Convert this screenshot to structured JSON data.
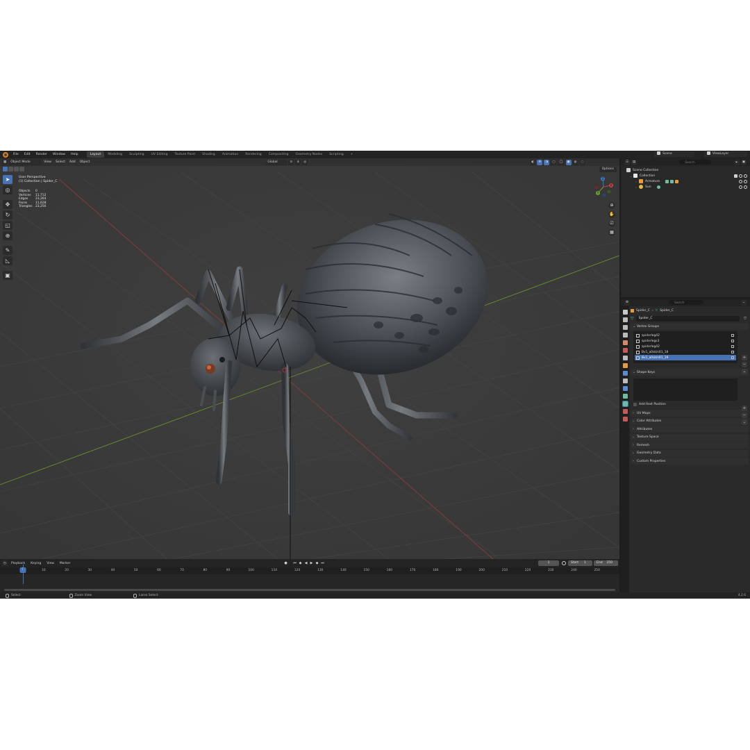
{
  "menu": [
    "File",
    "Edit",
    "Render",
    "Window",
    "Help"
  ],
  "workspaces": [
    {
      "label": "Layout",
      "active": true
    },
    {
      "label": "Modeling",
      "active": false
    },
    {
      "label": "Sculpting",
      "active": false
    },
    {
      "label": "UV Editing",
      "active": false
    },
    {
      "label": "Texture Paint",
      "active": false
    },
    {
      "label": "Shading",
      "active": false
    },
    {
      "label": "Animation",
      "active": false
    },
    {
      "label": "Rendering",
      "active": false
    },
    {
      "label": "Compositing",
      "active": false
    },
    {
      "label": "Geometry Nodes",
      "active": false
    },
    {
      "label": "Scripting",
      "active": false
    }
  ],
  "add_tab": "+",
  "scene": {
    "label": "Scene"
  },
  "view_layer": {
    "label": "ViewLayer"
  },
  "viewport": {
    "mode": "Object Mode",
    "menus": [
      "View",
      "Select",
      "Add",
      "Object"
    ],
    "orientation": "Global",
    "options": "Options",
    "perspective": "User Perspective",
    "collection_path": "(1) Collection | Spider_C",
    "stats": [
      {
        "label": "Objects",
        "value": "0"
      },
      {
        "label": "Vertices",
        "value": "11,712"
      },
      {
        "label": "Edges",
        "value": "23,264"
      },
      {
        "label": "Faces",
        "value": "11,628"
      },
      {
        "label": "Triangles",
        "value": "23,256"
      }
    ],
    "gizmo_axes": {
      "x": "X",
      "y": "Y",
      "z": "Z"
    },
    "colors": {
      "accent": "#4772b3",
      "x_axis": "#c4404a",
      "y_axis": "#6ba428",
      "z_axis": "#3b78c4"
    }
  },
  "timeline": {
    "menus": [
      "Playback",
      "Keying",
      "View",
      "Marker"
    ],
    "current_frame": "1",
    "start_label": "Start",
    "start": "1",
    "end_label": "End",
    "end": "250",
    "ticks": [
      "10",
      "20",
      "30",
      "40",
      "50",
      "60",
      "70",
      "80",
      "90",
      "100",
      "110",
      "120",
      "130",
      "140",
      "150",
      "160",
      "170",
      "180",
      "190",
      "200",
      "210",
      "220",
      "230",
      "240",
      "250"
    ],
    "frame_indicator": "1"
  },
  "statusbar": {
    "select": "Select",
    "zoom": "Zoom View",
    "lasso": "Lasso Select",
    "version": "4.2.0"
  },
  "outliner": {
    "search_placeholder": "Search",
    "scene_collection": "Scene Collection",
    "collection": "Collection",
    "armature": "Armature",
    "sun": "Sun"
  },
  "properties": {
    "search_placeholder": "Search",
    "crumb_object": "Spider_C",
    "crumb_mesh": "Spider_C",
    "mesh_name": "Spider_C",
    "vertex_groups_title": "Vertex Groups",
    "vertex_groups": [
      "spiderleg42",
      "spiderlegs3",
      "spiderleg42",
      "Bv1_a0skin01_18",
      "Bv1_a0skin01_19"
    ],
    "selected_vertex_group": 4,
    "shape_keys_title": "Shape Keys",
    "add_rest_position": "Add Rest Position",
    "sections": [
      "UV Maps",
      "Color Attributes",
      "Attributes",
      "Texture Space",
      "Remesh",
      "Geometry Data",
      "Custom Properties"
    ]
  }
}
